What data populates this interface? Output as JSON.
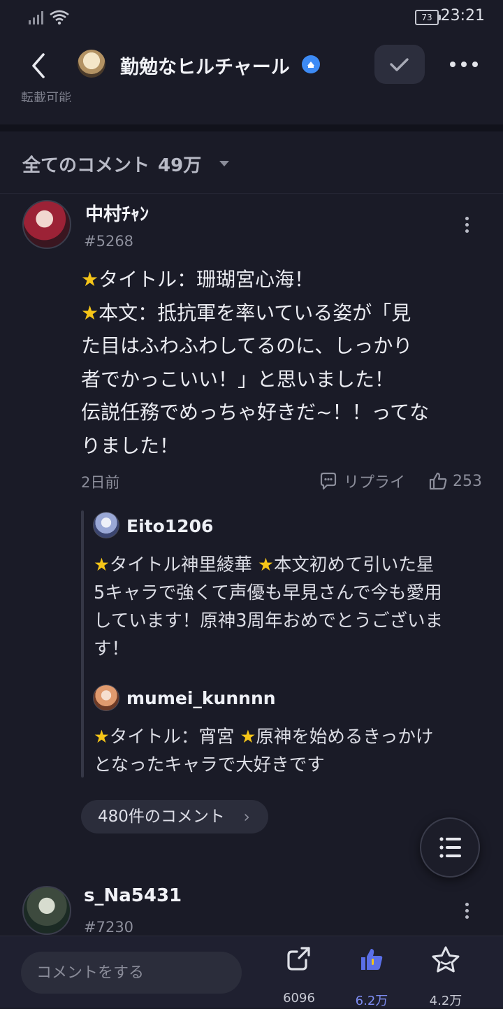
{
  "status_bar": {
    "time": "23:21",
    "battery": "73"
  },
  "header": {
    "title": "勤勉なヒルチャール",
    "cut_text": "転載可能"
  },
  "comments_header": {
    "label": "全てのコメント",
    "count": "49万"
  },
  "comment": {
    "username": "中村ﾁｬﾝ",
    "tag": "#5268",
    "body": {
      "line1": "タイトル：珊瑚宮心海！",
      "line2": "本文：抵抗軍を率いている姿が「見",
      "line3": "た目はふわふわしてるのに、しっかり",
      "line4": "者でかっこいい！」と思いました！",
      "line5": "伝説任務でめっちゃ好きだ~！！ってな",
      "line6": "りました！"
    },
    "time": "2日前",
    "reply_label": "リプライ",
    "likes": "253"
  },
  "replies": [
    {
      "username": "Eito1206",
      "l1a": "タイトル神里綾華 ",
      "l1b": "本文初めて引いた星",
      "l2": "5キャラで強くて声優も早見さんで今も愛用",
      "l3": "しています！原神3周年おめでとうございま",
      "l4": "す！"
    },
    {
      "username": "mumei_kunnnn",
      "l1a": "タイトル：宵宮 ",
      "l1b": "原神を始めるきっかけ",
      "l2": "となったキャラで大好きです"
    }
  ],
  "more_replies_label": "480件のコメント",
  "comment2": {
    "username": "s_Na5431",
    "tag": "#7230"
  },
  "bottom_bar": {
    "input_placeholder": "コメントをする",
    "share_count": "6096",
    "like_count": "6.2万",
    "fav_count": "4.2万"
  },
  "colors": {
    "accent": "#5a6fe8",
    "verified": "#3d8bf5",
    "star": "#f5c518"
  }
}
